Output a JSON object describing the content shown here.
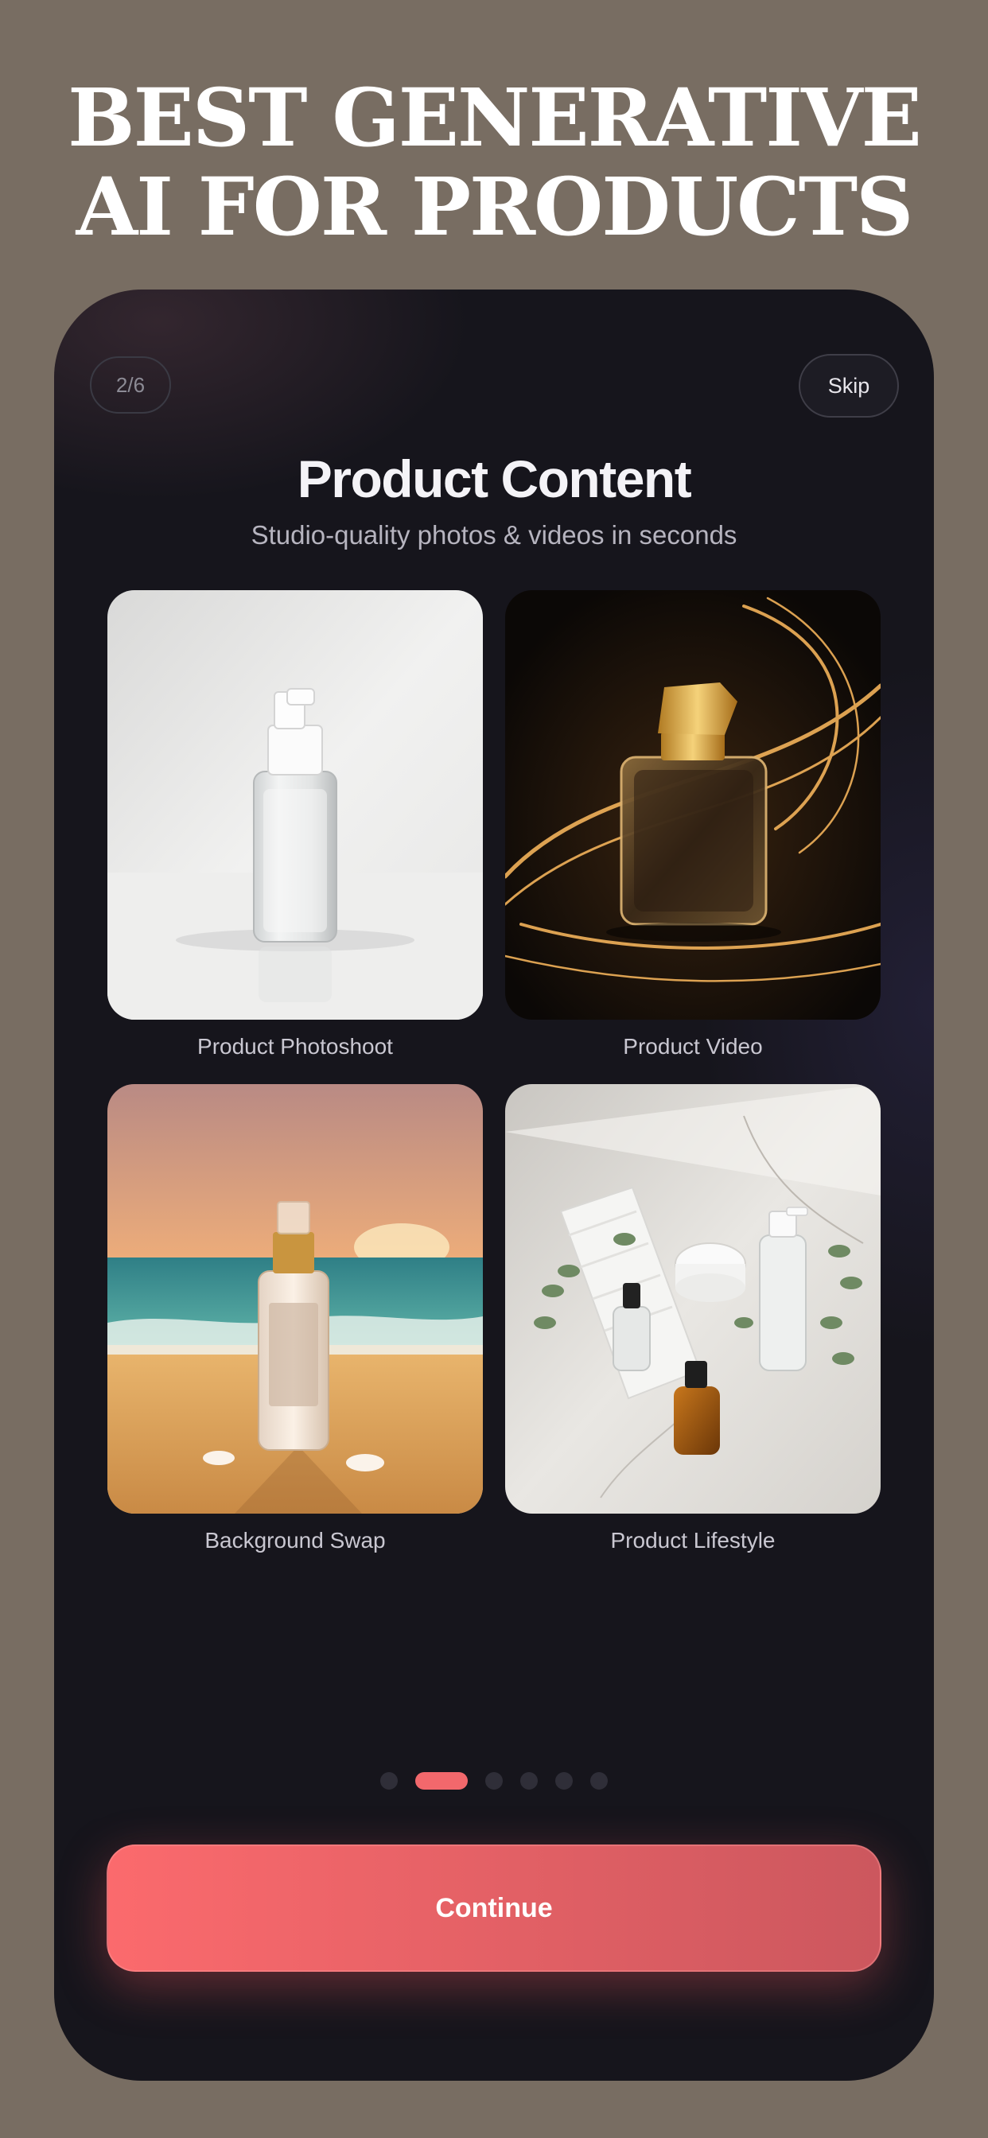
{
  "headline": {
    "line1": "BEST GENERATIVE",
    "line2": "AI FOR PRODUCTS"
  },
  "onboarding": {
    "counter": "2/6",
    "skip_label": "Skip",
    "title": "Product Content",
    "subtitle": "Studio-quality photos & videos in seconds",
    "cards": [
      {
        "label": "Product Photoshoot"
      },
      {
        "label": "Product Video"
      },
      {
        "label": "Background Swap"
      },
      {
        "label": "Product Lifestyle"
      }
    ],
    "pagination": {
      "total": 6,
      "current": 2
    },
    "continue_label": "Continue"
  },
  "colors": {
    "page_background": "#786d62",
    "phone_background": "#16151c",
    "accent": "#f2686c"
  }
}
